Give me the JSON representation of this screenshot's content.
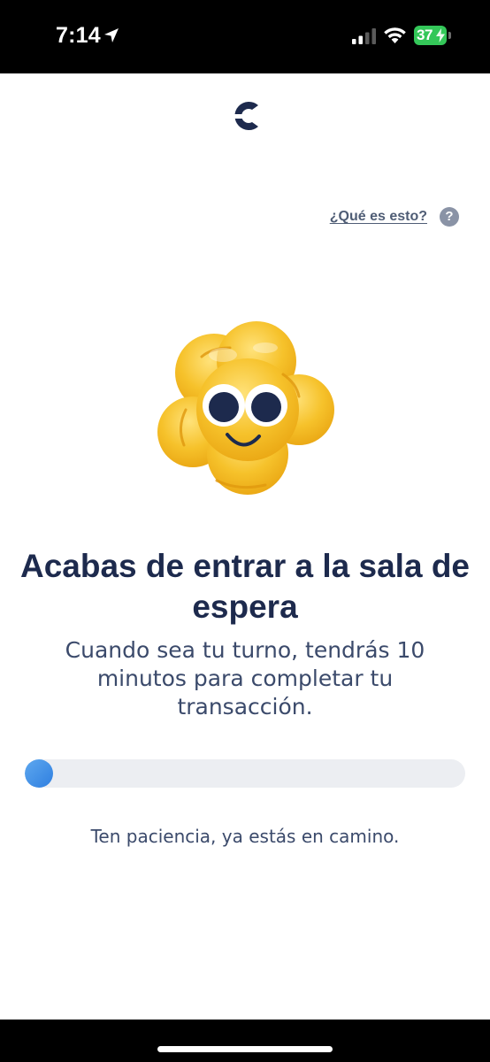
{
  "status_bar": {
    "time": "7:14",
    "battery_level": "37",
    "icons": [
      "location-arrow-icon",
      "cellular-signal-icon",
      "wifi-icon",
      "battery-charging-icon"
    ]
  },
  "header": {
    "logo": "brand-c-logo",
    "help_link": "¿Qué es esto?",
    "help_icon": "?"
  },
  "main": {
    "illustration": "popcorn-mascot",
    "title": "Acabas de entrar a la sala de espera",
    "subtitle": "Cuando sea tu turno, tendrás 10 minutos para completar tu transacción.",
    "progress": 0.05,
    "patience_text": "Ten paciencia, ya estás en camino."
  },
  "colors": {
    "navy": "#1d2a4d",
    "text": "#3b4a6b",
    "accent_blue": "#2f7fe0",
    "track": "#eceef2",
    "popcorn": "#f6c22b",
    "battery_green": "#34c759"
  }
}
